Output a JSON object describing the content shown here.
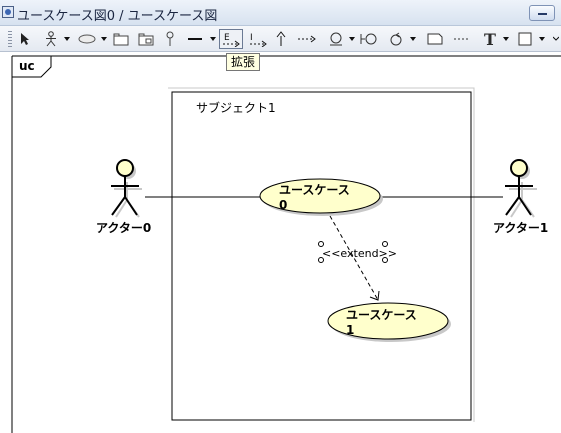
{
  "window": {
    "title": "ユースケース図0 / ユースケース図",
    "icon": "diagram-window-icon"
  },
  "toolbar": {
    "items": [
      {
        "name": "select-pointer",
        "icon": "arrow-pointer-icon"
      },
      {
        "name": "actor",
        "icon": "stick-figure-icon",
        "has_dropdown": true
      },
      {
        "name": "usecase",
        "icon": "ellipse-icon",
        "has_dropdown": true
      },
      {
        "name": "package",
        "icon": "folder-icon"
      },
      {
        "name": "subsystem",
        "icon": "subsystem-folder-icon"
      },
      {
        "name": "interface",
        "icon": "lollipop-icon"
      },
      {
        "name": "association",
        "icon": "line-icon",
        "has_dropdown": true
      },
      {
        "name": "extend",
        "icon": "extend-icon",
        "label": "E",
        "selected": true
      },
      {
        "name": "include",
        "icon": "include-icon",
        "label": "I"
      },
      {
        "name": "generalization",
        "icon": "generalization-arrow-icon"
      },
      {
        "name": "dependency",
        "icon": "dashed-arrow-icon"
      },
      {
        "name": "boundary",
        "icon": "boundary-icon",
        "has_dropdown": true
      },
      {
        "name": "control",
        "icon": "control-icon",
        "has_dropdown": true
      },
      {
        "name": "note",
        "icon": "note-icon"
      },
      {
        "name": "note-anchor",
        "icon": "dotted-line-icon"
      },
      {
        "name": "text",
        "icon": "text-t-icon",
        "label": "T",
        "has_dropdown": true
      },
      {
        "name": "rectangle",
        "icon": "rectangle-icon",
        "has_dropdown": true
      }
    ],
    "tooltip": "拡張"
  },
  "diagram": {
    "frame_label": "uc",
    "subject": "サブジェクト1",
    "actors": [
      {
        "id": "actor0",
        "name": "アクター0"
      },
      {
        "id": "actor1",
        "name": "アクター1"
      }
    ],
    "usecases": [
      {
        "id": "uc0",
        "line1": "ユースケース",
        "line2": "0"
      },
      {
        "id": "uc1",
        "line1": "ユースケース",
        "line2": "1"
      }
    ],
    "relationships": [
      {
        "type": "association",
        "from": "actor0",
        "to": "uc0"
      },
      {
        "type": "association",
        "from": "uc0",
        "to": "actor1"
      },
      {
        "type": "extend",
        "from": "uc0",
        "to": "uc1",
        "stereotype": "<<extend>>",
        "selected": true
      }
    ],
    "colors": {
      "usecase_fill": "#ffffcc",
      "actor_head_fill": "#ffffcc",
      "line": "#000000"
    }
  }
}
